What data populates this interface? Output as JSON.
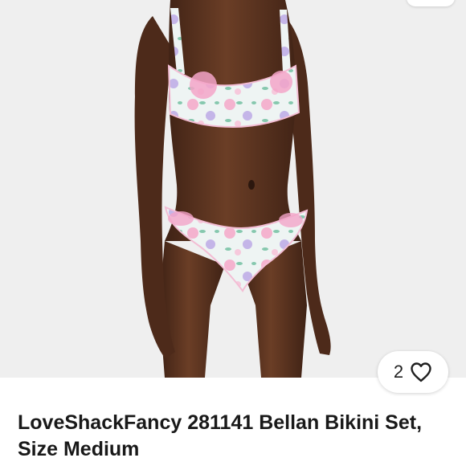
{
  "listing": {
    "title": "LoveShackFancy 281141 Bellan Bikini Set, Size Medium",
    "photo_alt": "Model wearing a floral bikini set",
    "photo_background": "#efefef"
  },
  "like_button": {
    "count": "2",
    "icon": "heart-outline-icon"
  },
  "colors": {
    "title_text": "#191919",
    "pill_background": "#ffffff",
    "skin": "#5a3422",
    "print_base": "#eef4f3",
    "print_pink": "#f2a6c8",
    "print_lavender": "#b7a7e0",
    "print_green": "#7fc3a9"
  }
}
